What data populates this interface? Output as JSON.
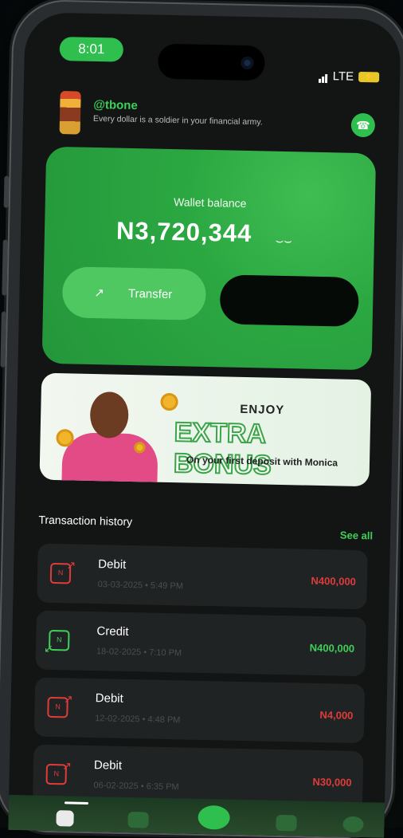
{
  "status_bar": {
    "time": "8:01",
    "network": "LTE"
  },
  "header": {
    "handle": "@tbone",
    "tagline": "Every dollar is a soldier in your financial army."
  },
  "wallet": {
    "label": "Wallet balance",
    "amount": "N3,720,344",
    "transfer_label": "Transfer"
  },
  "promo": {
    "enjoy": "ENJOY",
    "title": "EXTRA BONUS",
    "subtitle": "On your first deposit with Monica"
  },
  "transactions": {
    "header": "Transaction history",
    "see_all": "See all",
    "items": [
      {
        "type": "Debit",
        "date": "03-03-2025 • 5:49 PM",
        "amount": "N400,000",
        "color": "#e03b3b"
      },
      {
        "type": "Credit",
        "date": "18-02-2025 • 7:10 PM",
        "amount": "N400,000",
        "color": "#3ecf5a"
      },
      {
        "type": "Debit",
        "date": "12-02-2025 • 4:48 PM",
        "amount": "N4,000",
        "color": "#e03b3b"
      },
      {
        "type": "Debit",
        "date": "06-02-2025 • 6:35 PM",
        "amount": "N30,000",
        "color": "#e03b3b"
      }
    ]
  },
  "colors": {
    "accent": "#2fbf4f",
    "debit": "#e03b3b",
    "credit": "#3ecf5a"
  }
}
